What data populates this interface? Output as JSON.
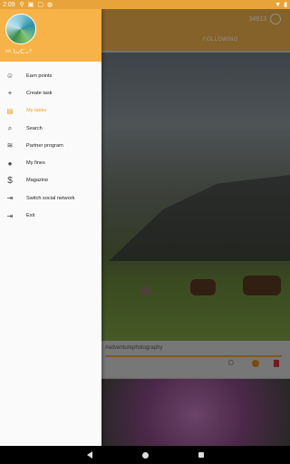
{
  "status_bar": {
    "time": "2:09",
    "icons": [
      "location-icon",
      "notification-icon",
      "square-icon",
      "sync-icon",
      "wifi-icon",
      "battery-icon"
    ]
  },
  "background": {
    "header_count": "34813",
    "header_tab": "FOLLOWING",
    "caption_text": "#adventurephotography"
  },
  "drawer": {
    "username": "ᵘᵃ Ꙇᴗᑕᴗᑦ",
    "menu": [
      {
        "label": "Earn points",
        "icon": "smiley-icon",
        "glyph": "☺",
        "active": false
      },
      {
        "label": "Create task",
        "icon": "plus-icon",
        "glyph": "+",
        "active": false
      },
      {
        "label": "My tasks",
        "icon": "calendar-icon",
        "glyph": "▤",
        "active": true
      },
      {
        "label": "Search",
        "icon": "search-icon",
        "glyph": "⌕",
        "active": false
      },
      {
        "label": "Partner program",
        "icon": "partner-icon",
        "glyph": "≋",
        "active": false
      },
      {
        "label": "My fines",
        "icon": "alert-icon",
        "glyph": "●",
        "active": false
      },
      {
        "label": "Magazine",
        "icon": "dollar-icon",
        "glyph": "$",
        "active": false
      },
      {
        "label": "Switch social network",
        "icon": "switch-icon",
        "glyph": "⇥",
        "active": false
      },
      {
        "label": "Exit",
        "icon": "exit-icon",
        "glyph": "⇥",
        "active": false
      }
    ]
  },
  "colors": {
    "accent": "#f7b347",
    "active_text": "#f0a22e",
    "status_bar": "#e8a43a"
  }
}
